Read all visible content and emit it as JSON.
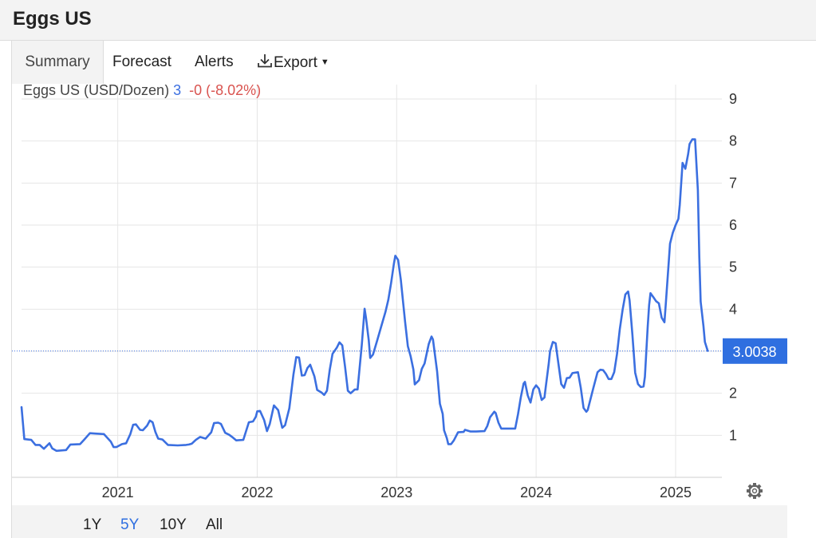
{
  "page": {
    "title": "Eggs US"
  },
  "tabs": [
    {
      "label": "Summary",
      "active": true
    },
    {
      "label": "Forecast",
      "active": false
    },
    {
      "label": "Alerts",
      "active": false
    },
    {
      "label": "Export",
      "active": false,
      "icon": "download-icon",
      "dropdown": true
    }
  ],
  "range_buttons": [
    {
      "label": "1Y",
      "active": false
    },
    {
      "label": "5Y",
      "active": true
    },
    {
      "label": "10Y",
      "active": false
    },
    {
      "label": "All",
      "active": false
    }
  ],
  "colors": {
    "line": "#3b6fe0",
    "change_negative": "#d9534f",
    "value_accent": "#3b6fe0",
    "last_badge_bg": "#2f6fe0",
    "grid": "#e6e6e6"
  },
  "chart_data": {
    "type": "line",
    "legend": {
      "series_label": "Eggs US (USD/Dozen)",
      "value": "3",
      "change": "-0 (-8.02%)"
    },
    "last_value_label": "3.0038",
    "last_value": 3.0038,
    "x_ticks": [
      "2021",
      "2022",
      "2023",
      "2024",
      "2025"
    ],
    "y_ticks": [
      "1",
      "2",
      "3",
      "4",
      "5",
      "6",
      "7",
      "8",
      "9"
    ],
    "xlim": [
      2020.31,
      2025.32
    ],
    "ylim": [
      0,
      9
    ],
    "grid": true,
    "settings_icon": "gear-icon",
    "series": [
      {
        "values": [
          [
            2020.31,
            1.67
          ],
          [
            2020.33,
            0.91
          ],
          [
            2020.38,
            0.89
          ],
          [
            2020.41,
            0.77
          ],
          [
            2020.44,
            0.77
          ],
          [
            2020.47,
            0.68
          ],
          [
            2020.51,
            0.81
          ],
          [
            2020.53,
            0.69
          ],
          [
            2020.56,
            0.63
          ],
          [
            2020.63,
            0.65
          ],
          [
            2020.66,
            0.78
          ],
          [
            2020.73,
            0.79
          ],
          [
            2020.76,
            0.9
          ],
          [
            2020.8,
            1.05
          ],
          [
            2020.84,
            1.04
          ],
          [
            2020.9,
            1.03
          ],
          [
            2020.95,
            0.85
          ],
          [
            2020.97,
            0.72
          ],
          [
            2020.99,
            0.72
          ],
          [
            2021.03,
            0.79
          ],
          [
            2021.06,
            0.81
          ],
          [
            2021.09,
            1.03
          ],
          [
            2021.11,
            1.25
          ],
          [
            2021.13,
            1.26
          ],
          [
            2021.16,
            1.13
          ],
          [
            2021.18,
            1.12
          ],
          [
            2021.21,
            1.23
          ],
          [
            2021.23,
            1.35
          ],
          [
            2021.25,
            1.31
          ],
          [
            2021.27,
            1.08
          ],
          [
            2021.29,
            0.92
          ],
          [
            2021.32,
            0.9
          ],
          [
            2021.36,
            0.77
          ],
          [
            2021.43,
            0.76
          ],
          [
            2021.49,
            0.77
          ],
          [
            2021.51,
            0.78
          ],
          [
            2021.53,
            0.8
          ],
          [
            2021.56,
            0.89
          ],
          [
            2021.59,
            0.96
          ],
          [
            2021.63,
            0.92
          ],
          [
            2021.67,
            1.07
          ],
          [
            2021.69,
            1.29
          ],
          [
            2021.72,
            1.3
          ],
          [
            2021.74,
            1.27
          ],
          [
            2021.77,
            1.06
          ],
          [
            2021.8,
            1.01
          ],
          [
            2021.82,
            0.96
          ],
          [
            2021.85,
            0.88
          ],
          [
            2021.9,
            0.89
          ],
          [
            2021.94,
            1.31
          ],
          [
            2021.97,
            1.33
          ],
          [
            2021.99,
            1.44
          ],
          [
            2022.0,
            1.57
          ],
          [
            2022.02,
            1.58
          ],
          [
            2022.05,
            1.36
          ],
          [
            2022.07,
            1.1
          ],
          [
            2022.09,
            1.27
          ],
          [
            2022.12,
            1.71
          ],
          [
            2022.15,
            1.6
          ],
          [
            2022.17,
            1.31
          ],
          [
            2022.18,
            1.18
          ],
          [
            2022.2,
            1.24
          ],
          [
            2022.23,
            1.64
          ],
          [
            2022.26,
            2.45
          ],
          [
            2022.28,
            2.86
          ],
          [
            2022.3,
            2.85
          ],
          [
            2022.32,
            2.42
          ],
          [
            2022.34,
            2.43
          ],
          [
            2022.36,
            2.6
          ],
          [
            2022.38,
            2.68
          ],
          [
            2022.41,
            2.4
          ],
          [
            2022.43,
            2.08
          ],
          [
            2022.46,
            2.02
          ],
          [
            2022.48,
            1.96
          ],
          [
            2022.5,
            2.06
          ],
          [
            2022.52,
            2.56
          ],
          [
            2022.54,
            2.94
          ],
          [
            2022.57,
            3.08
          ],
          [
            2022.59,
            3.21
          ],
          [
            2022.61,
            3.14
          ],
          [
            2022.63,
            2.63
          ],
          [
            2022.65,
            2.06
          ],
          [
            2022.67,
            2.0
          ],
          [
            2022.7,
            2.09
          ],
          [
            2022.72,
            2.09
          ],
          [
            2022.75,
            3.16
          ],
          [
            2022.77,
            4.01
          ],
          [
            2022.78,
            3.8
          ],
          [
            2022.8,
            3.26
          ],
          [
            2022.81,
            2.84
          ],
          [
            2022.83,
            2.92
          ],
          [
            2022.86,
            3.25
          ],
          [
            2022.89,
            3.6
          ],
          [
            2022.92,
            3.94
          ],
          [
            2022.94,
            4.22
          ],
          [
            2022.96,
            4.62
          ],
          [
            2022.98,
            5.08
          ],
          [
            2022.99,
            5.27
          ],
          [
            2023.01,
            5.17
          ],
          [
            2023.03,
            4.7
          ],
          [
            2023.06,
            3.71
          ],
          [
            2023.08,
            3.12
          ],
          [
            2023.1,
            2.88
          ],
          [
            2023.12,
            2.56
          ],
          [
            2023.13,
            2.21
          ],
          [
            2023.16,
            2.31
          ],
          [
            2023.18,
            2.58
          ],
          [
            2023.2,
            2.71
          ],
          [
            2023.23,
            3.17
          ],
          [
            2023.25,
            3.35
          ],
          [
            2023.26,
            3.28
          ],
          [
            2023.29,
            2.52
          ],
          [
            2023.31,
            1.75
          ],
          [
            2023.33,
            1.51
          ],
          [
            2023.34,
            1.12
          ],
          [
            2023.36,
            0.93
          ],
          [
            2023.37,
            0.79
          ],
          [
            2023.39,
            0.79
          ],
          [
            2023.41,
            0.88
          ],
          [
            2023.44,
            1.07
          ],
          [
            2023.48,
            1.08
          ],
          [
            2023.49,
            1.13
          ],
          [
            2023.53,
            1.09
          ],
          [
            2023.57,
            1.09
          ],
          [
            2023.63,
            1.1
          ],
          [
            2023.65,
            1.22
          ],
          [
            2023.67,
            1.43
          ],
          [
            2023.7,
            1.56
          ],
          [
            2023.71,
            1.53
          ],
          [
            2023.73,
            1.3
          ],
          [
            2023.75,
            1.16
          ],
          [
            2023.79,
            1.16
          ],
          [
            2023.85,
            1.16
          ],
          [
            2023.87,
            1.5
          ],
          [
            2023.89,
            1.9
          ],
          [
            2023.91,
            2.23
          ],
          [
            2023.92,
            2.27
          ],
          [
            2023.94,
            1.95
          ],
          [
            2023.96,
            1.78
          ],
          [
            2023.98,
            2.09
          ],
          [
            2024.0,
            2.19
          ],
          [
            2024.02,
            2.11
          ],
          [
            2024.04,
            1.84
          ],
          [
            2024.06,
            1.9
          ],
          [
            2024.07,
            2.18
          ],
          [
            2024.09,
            2.7
          ],
          [
            2024.1,
            3.0
          ],
          [
            2024.12,
            3.22
          ],
          [
            2024.14,
            3.19
          ],
          [
            2024.16,
            2.7
          ],
          [
            2024.18,
            2.22
          ],
          [
            2024.2,
            2.13
          ],
          [
            2024.22,
            2.36
          ],
          [
            2024.24,
            2.37
          ],
          [
            2024.26,
            2.48
          ],
          [
            2024.3,
            2.5
          ],
          [
            2024.32,
            2.13
          ],
          [
            2024.34,
            1.65
          ],
          [
            2024.36,
            1.56
          ],
          [
            2024.37,
            1.6
          ],
          [
            2024.41,
            2.12
          ],
          [
            2024.44,
            2.5
          ],
          [
            2024.46,
            2.56
          ],
          [
            2024.48,
            2.55
          ],
          [
            2024.5,
            2.46
          ],
          [
            2024.52,
            2.34
          ],
          [
            2024.54,
            2.34
          ],
          [
            2024.56,
            2.5
          ],
          [
            2024.58,
            2.93
          ],
          [
            2024.6,
            3.52
          ],
          [
            2024.62,
            3.98
          ],
          [
            2024.64,
            4.35
          ],
          [
            2024.66,
            4.42
          ],
          [
            2024.67,
            4.21
          ],
          [
            2024.69,
            3.4
          ],
          [
            2024.71,
            2.49
          ],
          [
            2024.73,
            2.22
          ],
          [
            2024.75,
            2.15
          ],
          [
            2024.77,
            2.16
          ],
          [
            2024.78,
            2.39
          ],
          [
            2024.8,
            3.58
          ],
          [
            2024.81,
            4.1
          ],
          [
            2024.82,
            4.38
          ],
          [
            2024.84,
            4.29
          ],
          [
            2024.86,
            4.19
          ],
          [
            2024.88,
            4.14
          ],
          [
            2024.9,
            3.8
          ],
          [
            2024.92,
            3.69
          ],
          [
            2024.93,
            4.13
          ],
          [
            2024.95,
            5.07
          ],
          [
            2024.96,
            5.56
          ],
          [
            2024.98,
            5.82
          ],
          [
            2025.0,
            6.0
          ],
          [
            2025.02,
            6.15
          ],
          [
            2025.03,
            6.48
          ],
          [
            2025.05,
            7.48
          ],
          [
            2025.07,
            7.34
          ],
          [
            2025.09,
            7.69
          ],
          [
            2025.1,
            7.93
          ],
          [
            2025.12,
            8.04
          ],
          [
            2025.14,
            8.04
          ],
          [
            2025.16,
            6.83
          ],
          [
            2025.17,
            5.24
          ],
          [
            2025.18,
            4.18
          ],
          [
            2025.2,
            3.6
          ],
          [
            2025.21,
            3.22
          ],
          [
            2025.23,
            3.01
          ]
        ]
      }
    ]
  }
}
